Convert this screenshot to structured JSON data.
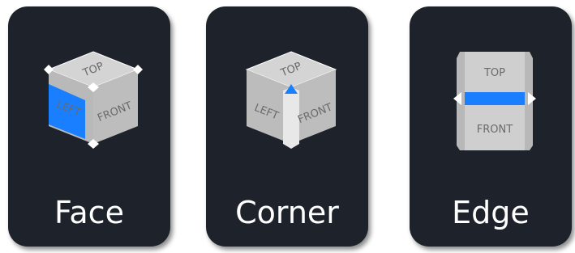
{
  "view_modes": [
    {
      "label": "Face",
      "highlight": "left-face",
      "cube_labels": {
        "top": "TOP",
        "left": "LEFT",
        "right": "FRONT"
      }
    },
    {
      "label": "Corner",
      "highlight": "top-corner",
      "cube_labels": {
        "top": "TOP",
        "left": "LEFT",
        "right": "FRONT"
      }
    },
    {
      "label": "Edge",
      "highlight": "top-front-edge",
      "cube_labels": {
        "top": "TOP",
        "bottom": "FRONT"
      }
    }
  ],
  "colors": {
    "card_background": "#1e222b",
    "highlight": "#1a7fff",
    "cube_top": "#d4d4d4",
    "cube_side": "#b9b9b9",
    "label_text": "#ffffff"
  },
  "icons": [
    "view-cube-face-icon",
    "view-cube-corner-icon",
    "view-cube-edge-icon"
  ]
}
